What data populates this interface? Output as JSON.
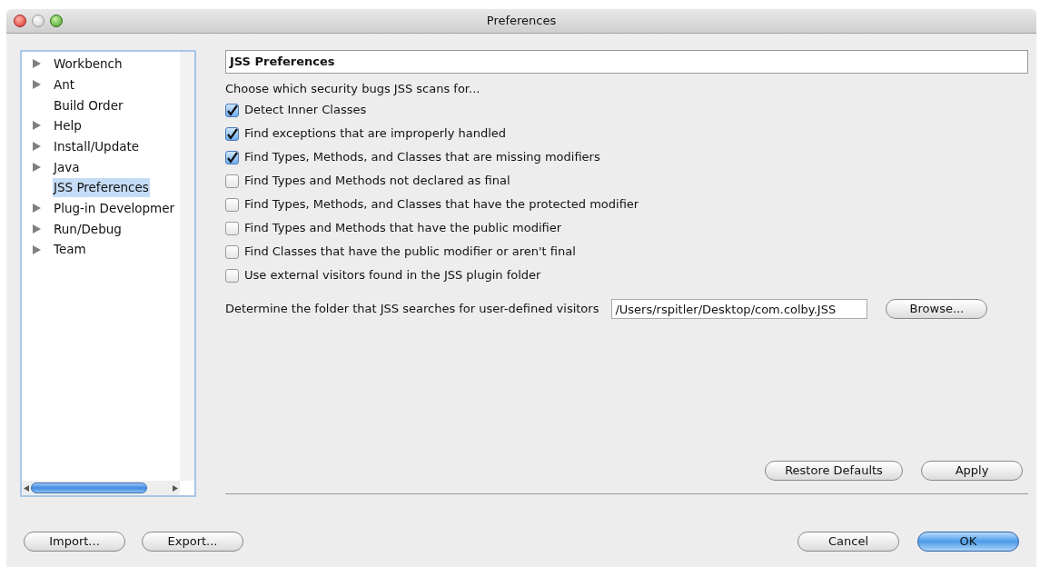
{
  "window": {
    "title": "Preferences"
  },
  "sidebar": {
    "items": [
      {
        "label": "Workbench",
        "expandable": true,
        "selected": false
      },
      {
        "label": "Ant",
        "expandable": true,
        "selected": false
      },
      {
        "label": "Build Order",
        "expandable": false,
        "selected": false
      },
      {
        "label": "Help",
        "expandable": true,
        "selected": false
      },
      {
        "label": "Install/Update",
        "expandable": true,
        "selected": false
      },
      {
        "label": "Java",
        "expandable": true,
        "selected": false
      },
      {
        "label": "JSS Preferences",
        "expandable": false,
        "selected": true
      },
      {
        "label": "Plug-in Developmer",
        "expandable": true,
        "selected": false
      },
      {
        "label": "Run/Debug",
        "expandable": true,
        "selected": false
      },
      {
        "label": "Team",
        "expandable": true,
        "selected": false
      }
    ]
  },
  "page": {
    "title": "JSS Preferences",
    "intro": "Choose which security bugs JSS scans for...",
    "options": [
      {
        "label": "Detect Inner Classes",
        "checked": true
      },
      {
        "label": "Find exceptions that are improperly handled",
        "checked": true
      },
      {
        "label": "Find Types, Methods, and Classes that are missing modifiers",
        "checked": true
      },
      {
        "label": "Find Types and Methods not declared as final",
        "checked": false
      },
      {
        "label": "Find Types, Methods, and Classes that have the protected modifier",
        "checked": false
      },
      {
        "label": "Find Types and Methods that have the public modifier",
        "checked": false
      },
      {
        "label": "Find Classes that have the public modifier or aren't final",
        "checked": false
      },
      {
        "label": "Use external visitors found in the JSS plugin folder",
        "checked": false
      }
    ],
    "folder_label": "Determine the folder that JSS searches for user-defined visitors",
    "folder_value": "/Users/rspitler/Desktop/com.colby.JSS",
    "browse_button": "Browse...",
    "restore_button": "Restore Defaults",
    "apply_button": "Apply"
  },
  "footer": {
    "left_buttons": [
      "Import...",
      "Export..."
    ],
    "cancel_button": "Cancel",
    "ok_button": "OK"
  }
}
